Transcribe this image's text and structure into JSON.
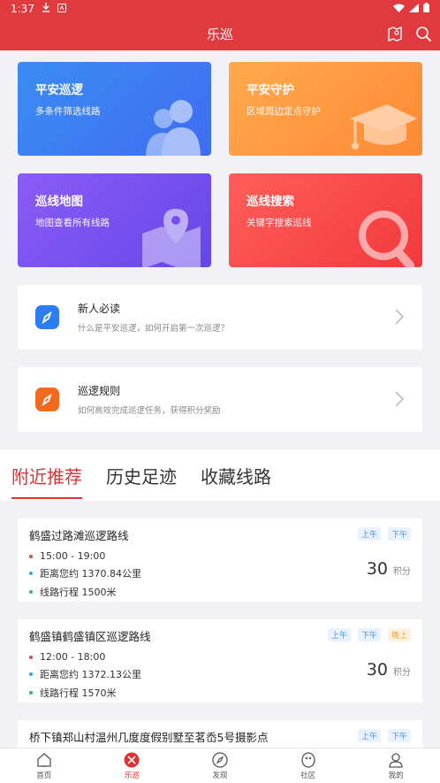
{
  "status": {
    "time": "1:37"
  },
  "header": {
    "title": "乐巡"
  },
  "features": [
    {
      "title": "平安巡逻",
      "subtitle": "多条件筛选线路"
    },
    {
      "title": "平安守护",
      "subtitle": "区域周边定点守护"
    },
    {
      "title": "巡线地图",
      "subtitle": "地图查看所有线路"
    },
    {
      "title": "巡线搜索",
      "subtitle": "关键字搜索巡线"
    }
  ],
  "guides": [
    {
      "title": "新人必读",
      "subtitle": "什么是平安巡逻，如何开启第一次巡逻？"
    },
    {
      "title": "巡逻规则",
      "subtitle": "如何高效完成巡逻任务，获得积分奖励"
    }
  ],
  "tabs": [
    "附近推荐",
    "历史足迹",
    "收藏线路"
  ],
  "routes": [
    {
      "title": "鹤盛过路滩巡逻路线",
      "tags": [
        "上午",
        "下午"
      ],
      "time": "15:00 - 19:00",
      "distance": "距离您约 1370.84公里",
      "length": "线路行程 1500米",
      "points": "30",
      "unit": "积分"
    },
    {
      "title": "鹤盛镇鹤盛镇区巡逻路线",
      "tags": [
        "上午",
        "下午",
        "晚上"
      ],
      "time": "12:00 - 18:00",
      "distance": "距离您约 1372.13公里",
      "length": "线路行程 1570米",
      "points": "30",
      "unit": "积分"
    },
    {
      "title": "桥下镇郑山村温州几度度假别墅至茗岙5号摄影点",
      "tags": [
        "上午",
        "下午"
      ]
    }
  ],
  "nav": [
    "首页",
    "乐巡",
    "发现",
    "社区",
    "我的"
  ],
  "colors": {
    "brand": "#e03a3e",
    "active": "#e23134"
  }
}
